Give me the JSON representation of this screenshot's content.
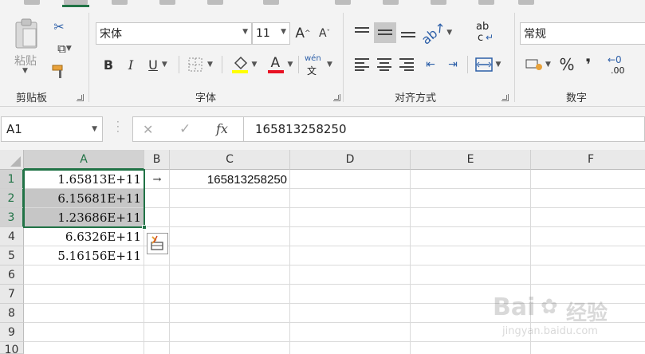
{
  "ribbon": {
    "clipboard": {
      "paste_label": "粘贴",
      "group_label": "剪贴板"
    },
    "font": {
      "font_name": "宋体",
      "font_size": "11",
      "bold": "B",
      "italic": "I",
      "underline": "U",
      "font_color_letter": "A",
      "phonetic_top": "wén",
      "phonetic_bottom": "文",
      "grow_font": "A",
      "shrink_font": "A",
      "group_label": "字体",
      "highlight_color": "#ffff00",
      "font_color": "#e81123"
    },
    "alignment": {
      "group_label": "对齐方式",
      "wrap_top": "ab",
      "wrap_bottom": "c"
    },
    "number": {
      "format": "常规",
      "percent": "%",
      "comma": "❜",
      "increase_decimal": ".00",
      "group_label": "数字"
    },
    "accent_color": "#217346"
  },
  "formula_bar": {
    "name_box": "A1",
    "cancel_icon": "✕",
    "enter_icon": "✓",
    "fx_label": "fx",
    "content": "165813258250"
  },
  "sheet": {
    "columns": [
      "A",
      "B",
      "C",
      "D",
      "E",
      "F"
    ],
    "rows": [
      "1",
      "2",
      "3",
      "4",
      "5",
      "6",
      "7",
      "8",
      "9",
      "10"
    ],
    "cells": {
      "A1": "1.65813E+11",
      "A2": "6.15681E+11",
      "A3": "1.23686E+11",
      "A4": "6.6326E+11",
      "A5": "5.16156E+11",
      "B1": "→",
      "C1": "165813258250"
    },
    "active_cell": "A1",
    "selection": "A1:A3"
  },
  "watermark": {
    "brand": "Bai",
    "brand_tail": "经验",
    "url": "jingyan.baidu.com"
  }
}
